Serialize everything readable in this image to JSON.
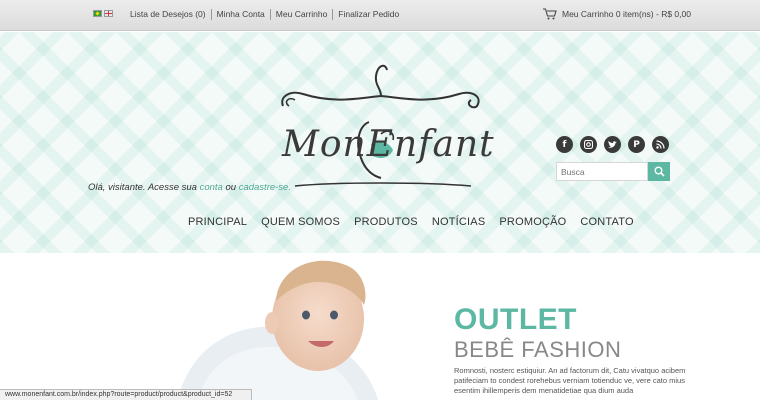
{
  "topbar": {
    "links": [
      "Lista de Desejos (0)",
      "Minha Conta",
      "Meu Carrinho",
      "Finalizar Pedido"
    ],
    "cart_text": "Meu Carrinho 0 item(ns) - R$ 0,00",
    "flags": [
      "brazil-flag",
      "uk-flag"
    ]
  },
  "header": {
    "logo_text": "MonEnfant",
    "greeting_prefix": "Olá, visitante. Acesse sua",
    "greeting_link_login": "conta",
    "greeting_or": "ou",
    "greeting_link_register": "cadastre-se.",
    "socials": [
      "facebook-icon",
      "instagram-icon",
      "twitter-icon",
      "pinterest-icon",
      "rss-icon"
    ],
    "search_placeholder": "Busca"
  },
  "nav": {
    "items": [
      "PRINCIPAL",
      "QUEM SOMOS",
      "PRODUTOS",
      "NOTÍCIAS",
      "PROMOÇÃO",
      "CONTATO"
    ]
  },
  "hero": {
    "title": "OUTLET",
    "subtitle": "BEBÊ FASHION",
    "description": "Romnosti, nosterc estiquiur. An ad factorum dit, Catu vivatquo acibem patifeciam to condest rorehebus verniam totienduc ve, vere cato mius esentim ihillemperis dem menatidetiae qua dium auda"
  },
  "status_url": "www.monenfant.com.br/index.php?route=product/product&product_id=52",
  "colors": {
    "accent": "#5cb8a3",
    "text": "#333333"
  }
}
